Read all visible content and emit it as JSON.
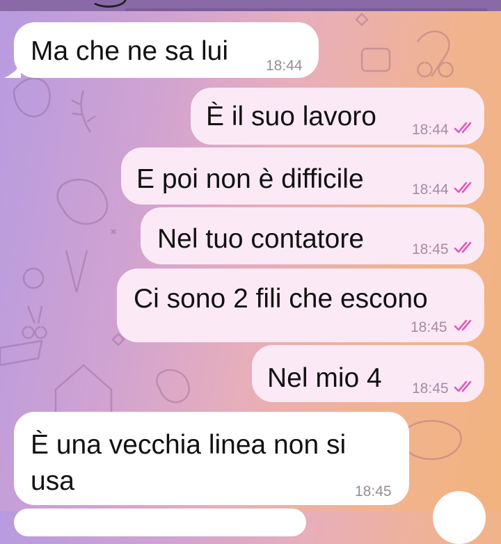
{
  "chat": {
    "messages": [
      {
        "id": "m1",
        "direction": "incoming",
        "text": "Ma che ne sa lui",
        "time": "18:44"
      },
      {
        "id": "m2",
        "direction": "outgoing",
        "text": "È il suo lavoro",
        "time": "18:44",
        "status": "read"
      },
      {
        "id": "m3",
        "direction": "outgoing",
        "text": "E poi non è difficile",
        "time": "18:44",
        "status": "read"
      },
      {
        "id": "m4",
        "direction": "outgoing",
        "text": "Nel tuo contatore",
        "time": "18:45",
        "status": "read"
      },
      {
        "id": "m5",
        "direction": "outgoing",
        "text": "Ci sono 2 fili che escono",
        "time": "18:45",
        "status": "read"
      },
      {
        "id": "m6",
        "direction": "outgoing",
        "text": "Nel mio 4",
        "time": "18:45",
        "status": "read"
      },
      {
        "id": "m7",
        "direction": "incoming",
        "text_line1": "È una vecchia linea non si",
        "text_line2": "usa",
        "time": "18:45"
      }
    ]
  },
  "icons": {
    "read_ticks": "double-check-icon",
    "scroll_down": "scroll-down-button"
  },
  "colors": {
    "incoming_bubble": "#ffffff",
    "outgoing_bubble": "#fbeaf6",
    "read_ticks": "#e05ab8",
    "top_bar": "#8a6aa6"
  }
}
